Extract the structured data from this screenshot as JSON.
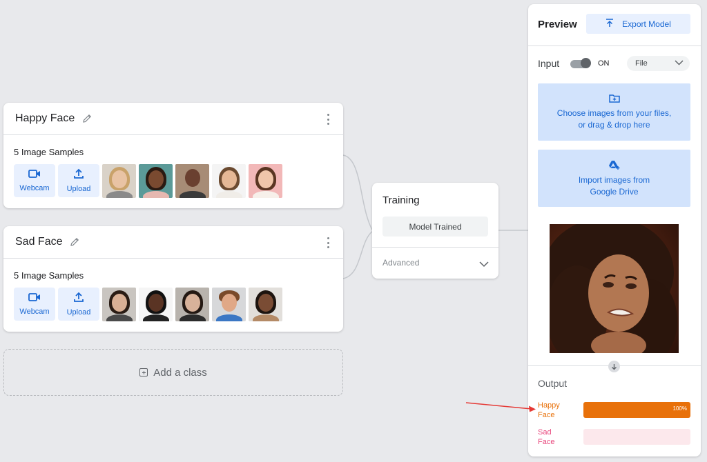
{
  "classes": [
    {
      "name": "Happy Face",
      "samples_label": "5 Image Samples",
      "webcam_label": "Webcam",
      "upload_label": "Upload"
    },
    {
      "name": "Sad Face",
      "samples_label": "5 Image Samples",
      "webcam_label": "Webcam",
      "upload_label": "Upload"
    }
  ],
  "add_class_label": "Add a class",
  "training": {
    "title": "Training",
    "button_label": "Model Trained",
    "advanced_label": "Advanced"
  },
  "preview": {
    "title": "Preview",
    "export_label": "Export Model",
    "input_label": "Input",
    "toggle_state": "ON",
    "source_select": "File",
    "dropzone_files": [
      "Choose images from your files,",
      "or drag & drop here"
    ],
    "dropzone_drive": [
      "Import images from",
      "Google Drive"
    ],
    "output_label": "Output",
    "outputs": [
      {
        "name_lines": [
          "Happy",
          "Face"
        ],
        "confidence": 1.0,
        "confidence_label": "100%"
      },
      {
        "name_lines": [
          "Sad",
          "Face"
        ],
        "confidence": 0.0,
        "confidence_label": ""
      }
    ]
  },
  "colors": {
    "accent_blue": "#1967d2",
    "happy_orange": "#e8710a",
    "sad_pink": "#e8467c",
    "annotation_arrow": "#e53935"
  },
  "icons": {
    "edit": "pencil-icon",
    "menu": "more-vert-icon",
    "webcam": "videocam-icon",
    "upload": "upload-icon",
    "export": "upload-icon",
    "dropdown": "chevron-down-icon",
    "folder": "folder-add-icon",
    "drive": "google-drive-icon",
    "down": "arrow-down-icon",
    "add": "add-box-icon"
  }
}
